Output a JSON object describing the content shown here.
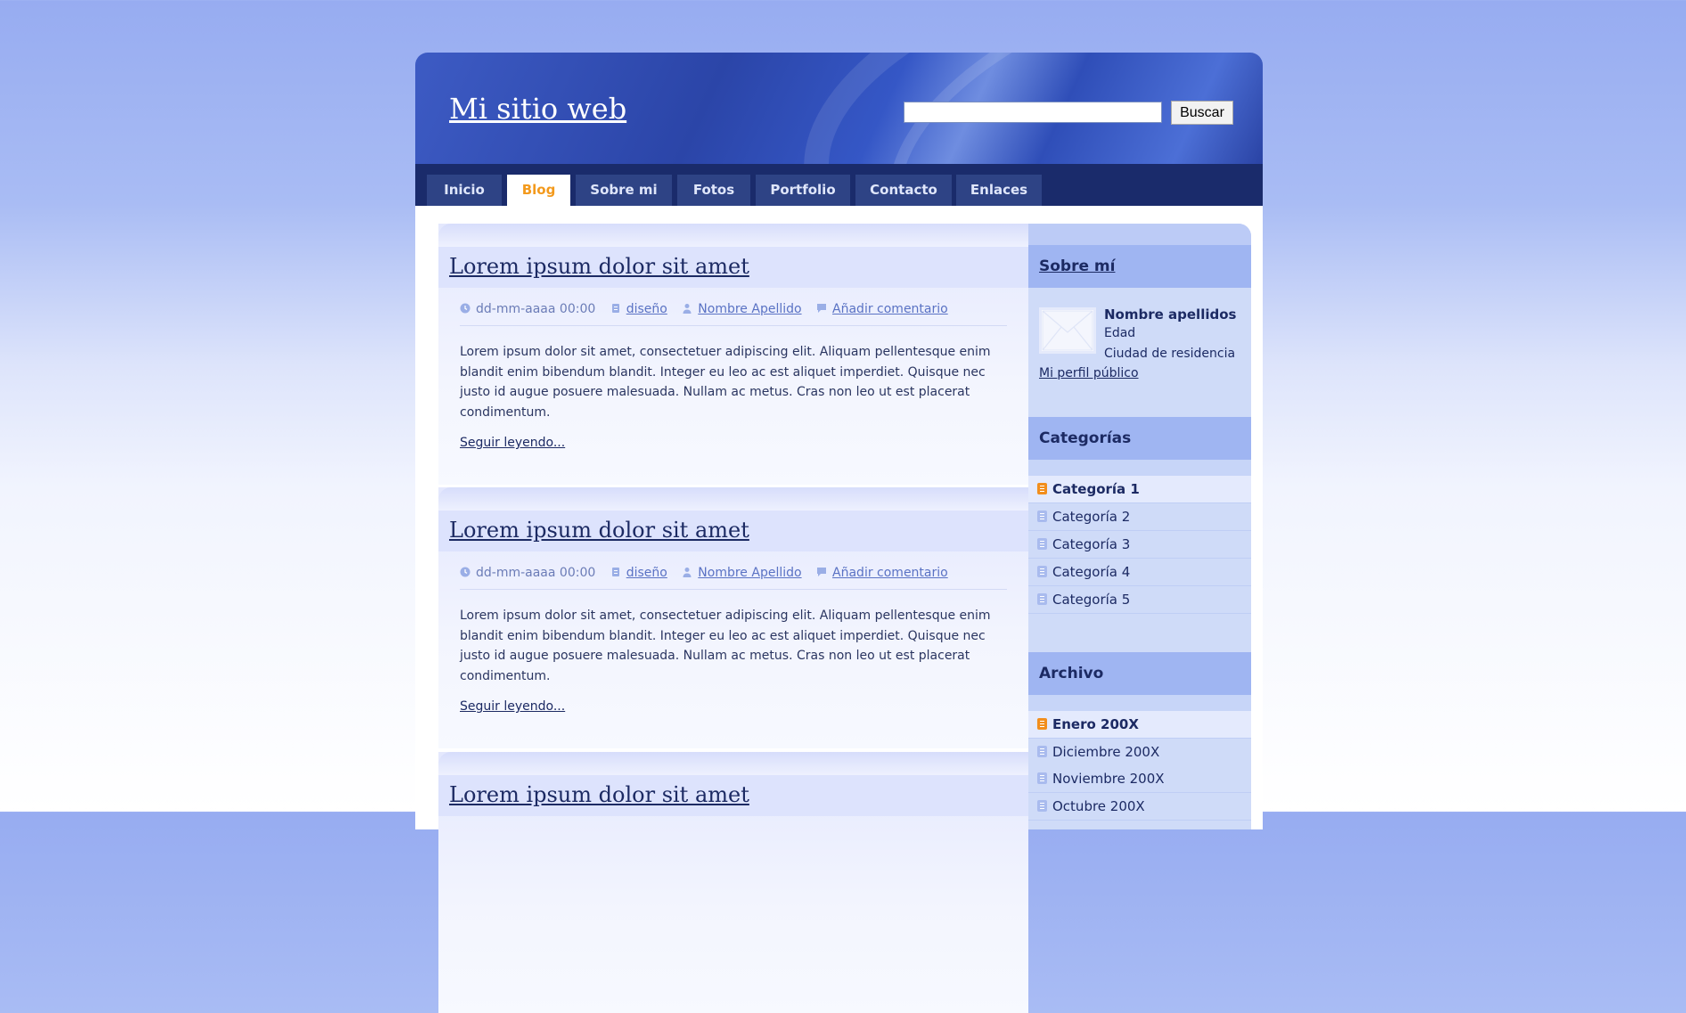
{
  "header": {
    "site_title": "Mi sitio web",
    "search_value": "",
    "search_button": "Buscar"
  },
  "nav": {
    "items": [
      "Inicio",
      "Blog",
      "Sobre mi",
      "Fotos",
      "Portfolio",
      "Contacto",
      "Enlaces"
    ],
    "active": "Blog"
  },
  "posts": [
    {
      "title": "Lorem ipsum dolor sit amet",
      "date": "dd-mm-aaaa 00:00",
      "category": "diseño",
      "author": "Nombre Apellido",
      "comment_link": "Añadir comentario",
      "excerpt": "Lorem ipsum dolor sit amet, consectetuer adipiscing elit. Aliquam pellentesque enim blandit enim bibendum blandit. Integer eu leo ac est aliquet imperdiet. Quisque nec justo id augue posuere malesuada. Nullam ac metus. Cras non leo ut est placerat condimentum.",
      "read_more": "Seguir leyendo..."
    },
    {
      "title": "Lorem ipsum dolor sit amet",
      "date": "dd-mm-aaaa 00:00",
      "category": "diseño",
      "author": "Nombre Apellido",
      "comment_link": "Añadir comentario",
      "excerpt": "Lorem ipsum dolor sit amet, consectetuer adipiscing elit. Aliquam pellentesque enim blandit enim bibendum blandit. Integer eu leo ac est aliquet imperdiet. Quisque nec justo id augue posuere malesuada. Nullam ac metus. Cras non leo ut est placerat condimentum.",
      "read_more": "Seguir leyendo..."
    },
    {
      "title": "Lorem ipsum dolor sit amet"
    }
  ],
  "sidebar": {
    "about": {
      "heading": "Sobre mí",
      "name": "Nombre apellidos",
      "age": "Edad",
      "city": "Ciudad de residencia",
      "profile_link": "Mi perfil público"
    },
    "categories": {
      "heading": "Categorías",
      "items": [
        "Categoría 1",
        "Categoría 2",
        "Categoría 3",
        "Categoría 4",
        "Categoría 5"
      ],
      "active": "Categoría 1"
    },
    "archive": {
      "heading": "Archivo",
      "items": [
        "Enero 200X",
        "Diciembre 200X",
        "Noviembre 200X",
        "Octubre 200X"
      ],
      "active": "Enero 200X"
    }
  },
  "colors": {
    "accent": "#f39a1d",
    "nav_bg": "#1a2b6b",
    "text_dark": "#1c2a63"
  }
}
